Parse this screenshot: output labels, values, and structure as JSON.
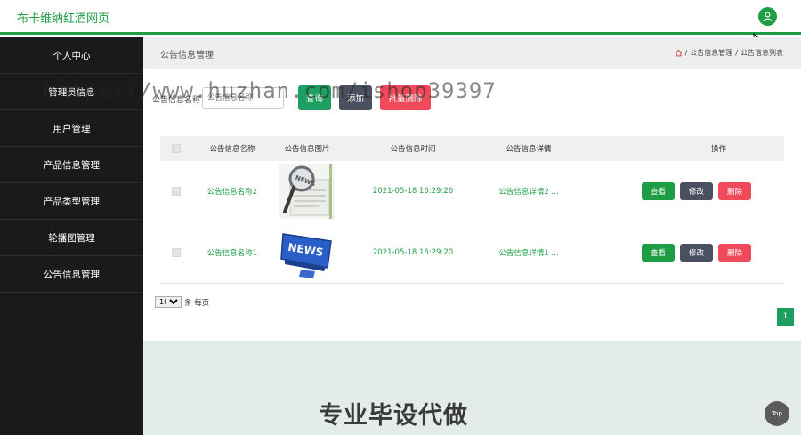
{
  "header": {
    "title": "布卡维纳红酒网页",
    "user_icon": "user-icon"
  },
  "sidebar": {
    "items": [
      {
        "label": "个人中心"
      },
      {
        "label": "管理员信息"
      },
      {
        "label": "用户管理"
      },
      {
        "label": "产品信息管理"
      },
      {
        "label": "产品类型管理"
      },
      {
        "label": "轮播图管理"
      },
      {
        "label": "公告信息管理"
      }
    ]
  },
  "breadcrumb": {
    "title": "公告信息管理",
    "path": [
      "公告信息管理",
      "公告信息列表"
    ],
    "separator": "/"
  },
  "search": {
    "label": "公告信息名称",
    "placeholder": "公告信息名称",
    "query_label": "查询",
    "add_label": "添加",
    "batch_delete_label": "批量删除"
  },
  "watermark": "https://www.huzhan.com/ishop39397",
  "table": {
    "headers": {
      "name": "公告信息名称",
      "image": "公告信息图片",
      "time": "公告信息时间",
      "detail": "公告信息详情",
      "ops": "操作"
    },
    "rows": [
      {
        "name": "公告信息名称2",
        "time": "2021-05-18 16:29:26",
        "detail": "公告信息详情2 ...",
        "image_icon": "magnifier-news-image"
      },
      {
        "name": "公告信息名称1",
        "time": "2021-05-18 16:29:20",
        "detail": "公告信息详情1 ...",
        "image_icon": "news-sign-image"
      }
    ],
    "op_labels": {
      "view": "查看",
      "edit": "修改",
      "delete": "删除"
    },
    "news_text": "NEWS"
  },
  "pager": {
    "page_size": "10",
    "per_page_text": "条 每页",
    "current_page": "1"
  },
  "footer": {
    "watermark_text": "专业毕设代做",
    "top_label": "Top"
  },
  "colors": {
    "accent": "#1e9e44",
    "sidebar_bg": "#1a1a1a",
    "danger": "#f04a5a",
    "secondary": "#4a5060"
  }
}
